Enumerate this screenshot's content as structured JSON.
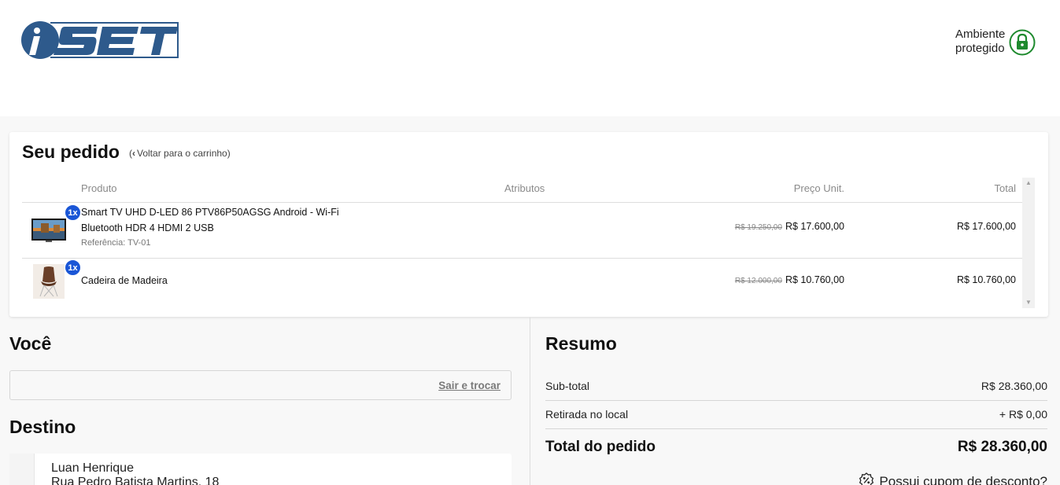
{
  "header": {
    "secure_line1": "Ambiente",
    "secure_line2": "protegido"
  },
  "order": {
    "title": "Seu pedido",
    "back_label": "Voltar para o carrinho",
    "columns": {
      "product": "Produto",
      "attributes": "Atributos",
      "unit_price": "Preço Unit.",
      "total": "Total"
    },
    "items": [
      {
        "qty": "1x",
        "name_line1": "Smart TV UHD D-LED 86 PTV86P50AGSG Android - Wi-Fi",
        "name_line2": "Bluetooth HDR 4 HDMI 2 USB",
        "reference": "Referência: TV-01",
        "old_price": "R$ 19.250,00",
        "price": "R$ 17.600,00",
        "total": "R$ 17.600,00"
      },
      {
        "qty": "1x",
        "name_line1": "Cadeira de Madeira",
        "old_price": "R$ 12.000,00",
        "price": "R$ 10.760,00",
        "total": "R$ 10.760,00"
      }
    ]
  },
  "you": {
    "title": "Você",
    "logout_label": "Sair e trocar"
  },
  "destination": {
    "title": "Destino",
    "name": "Luan Henrique",
    "street": "Rua Pedro Batista Martins, 18"
  },
  "summary": {
    "title": "Resumo",
    "subtotal_label": "Sub-total",
    "subtotal_value": "R$ 28.360,00",
    "pickup_label": "Retirada no local",
    "pickup_value": "+ R$ 0,00",
    "total_label": "Total do pedido",
    "total_value": "R$ 28.360,00",
    "coupon_label": "Possui cupom de desconto?"
  },
  "colors": {
    "brand": "#2e5a8c",
    "secure_green": "#1e8a2e",
    "qty_badge": "#1a56d6"
  }
}
